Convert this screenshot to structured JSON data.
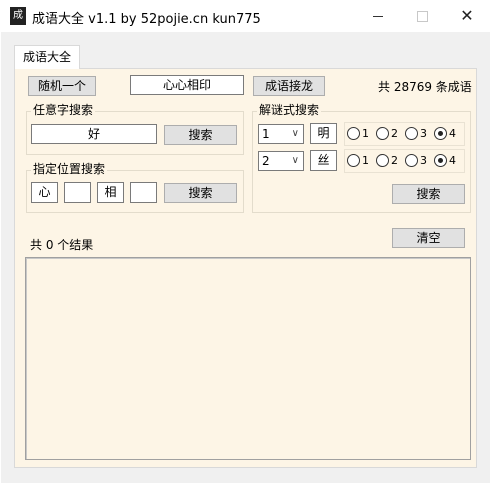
{
  "window": {
    "icon_glyph": "成",
    "title": "成语大全 v1.1 by 52pojie.cn kun775",
    "minimize_glyph": "—",
    "maximize_glyph": "☐",
    "close_glyph": "✕"
  },
  "tab": {
    "label": "成语大全"
  },
  "top_row": {
    "random_button": "随机一个",
    "current_idiom": "心心相印",
    "chain_button": "成语接龙",
    "count_text": "共 28769 条成语"
  },
  "any_char_search": {
    "group_label": "任意字搜索",
    "input_value": "好",
    "search_button": "搜索"
  },
  "position_search": {
    "group_label": "指定位置搜索",
    "chars": [
      "心",
      "",
      "相",
      ""
    ],
    "search_button": "搜索"
  },
  "riddle_search": {
    "group_label": "解谜式搜索",
    "rows": [
      {
        "select_value": "1",
        "char": "明",
        "options": [
          "1",
          "2",
          "3",
          "4"
        ],
        "selected": "4"
      },
      {
        "select_value": "2",
        "char": "丝",
        "options": [
          "1",
          "2",
          "3",
          "4"
        ],
        "selected": "4"
      }
    ],
    "search_button": "搜索"
  },
  "results": {
    "count_text": "共 0 个结果",
    "clear_button": "清空",
    "items": []
  }
}
